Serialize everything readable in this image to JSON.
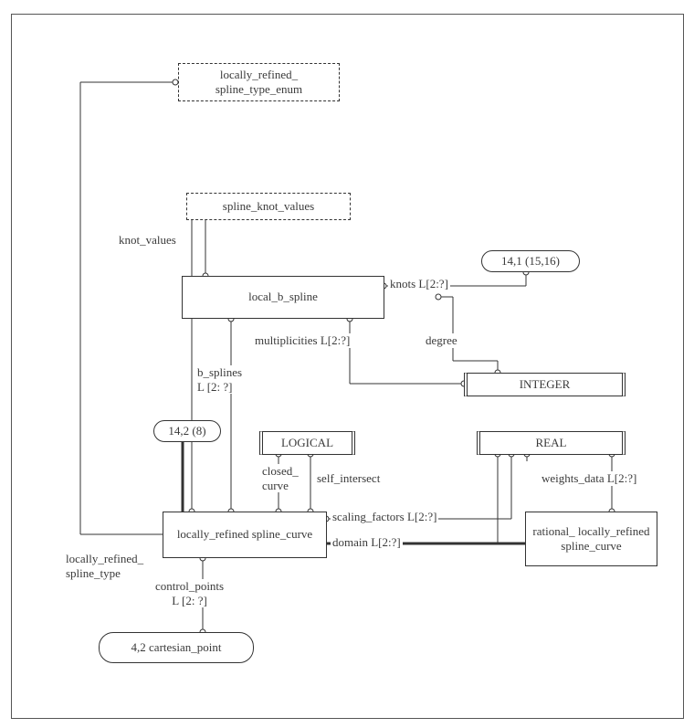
{
  "nodes": {
    "enum_box": "locally_refined_\nspline_type_enum",
    "knot_values_box": "spline_knot_values",
    "local_b_spline": "local_b_spline",
    "integer": "INTEGER",
    "logical": "LOGICAL",
    "real": "REAL",
    "lr_curve": "locally_refined\nspline_curve",
    "rational_lr_curve": "rational_\nlocally_refined\nspline_curve",
    "cartesian_point": "4,2 cartesian_point",
    "ref_14_2_8": "14,2 (8)",
    "ref_14_1_1516": "14,1 (15,16)"
  },
  "edges": {
    "knot_values": "knot_values",
    "b_splines": "b_splines\nL [2: ?]",
    "multiplicities": "multiplicities L[2:?]",
    "degree": "degree",
    "knots": "knots L[2:?]",
    "closed_curve": "closed_\ncurve",
    "self_intersect": "self_intersect",
    "scaling_factors": "scaling_factors L[2:?]",
    "domain": "domain L[2:?]",
    "weights_data": "weights_data L[2:?]",
    "spline_type": "locally_refined_\nspline_type",
    "control_points": "control_points\nL [2: ?]"
  }
}
